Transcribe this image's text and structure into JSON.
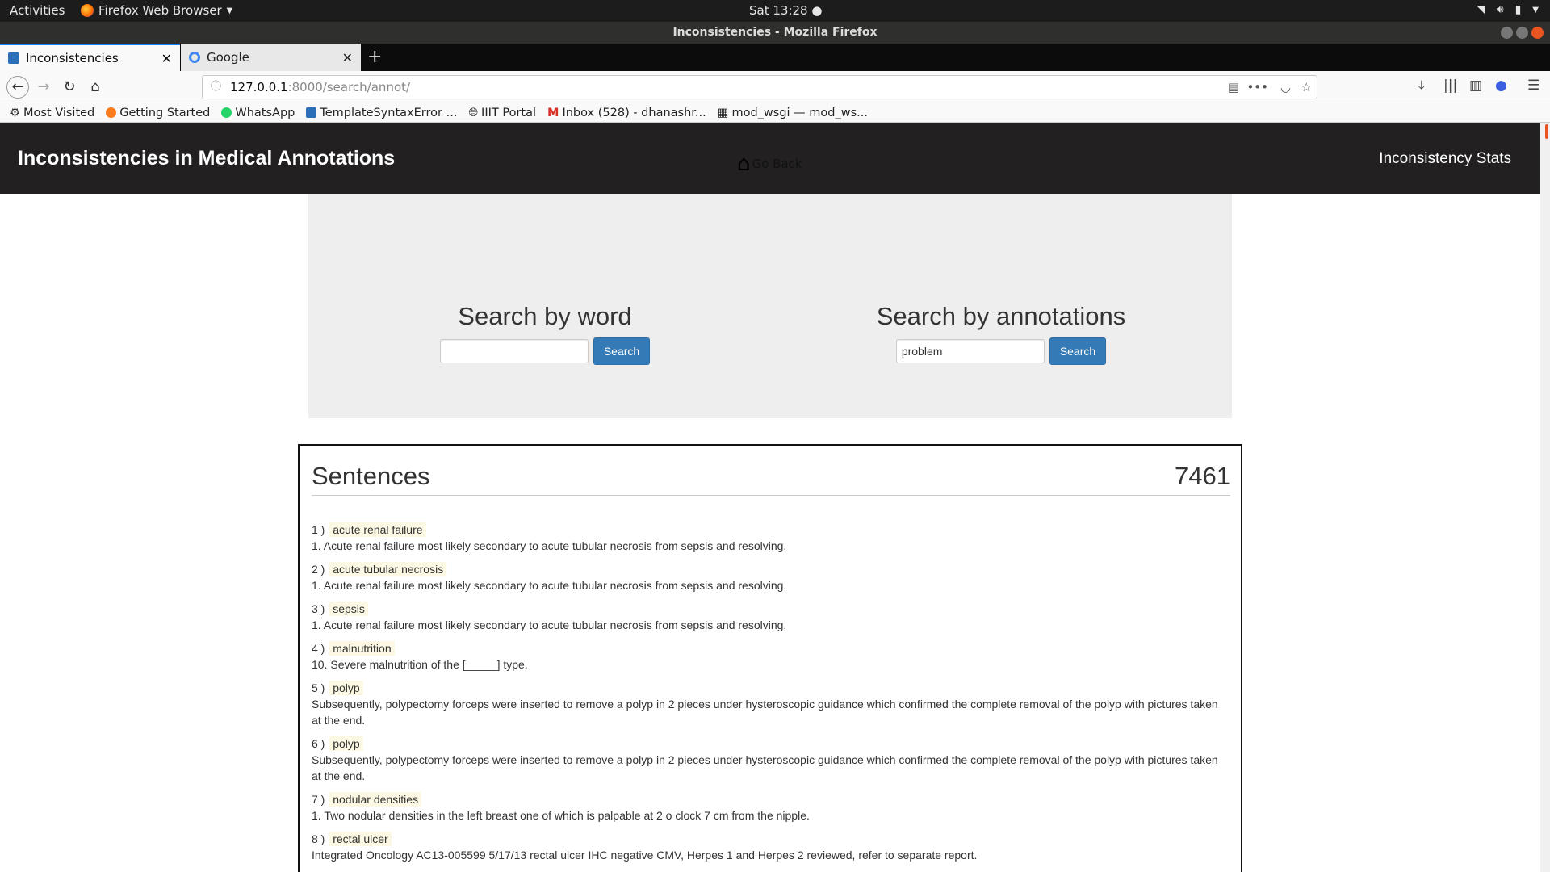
{
  "system": {
    "activities": "Activities",
    "app_name": "Firefox Web Browser",
    "clock": "Sat 13:28"
  },
  "window": {
    "title": "Inconsistencies - Mozilla Firefox"
  },
  "tabs": [
    {
      "label": "Inconsistencies",
      "active": true
    },
    {
      "label": "Google",
      "active": false
    }
  ],
  "urlbar": {
    "host": "127.0.0.1",
    "path": ":8000/search/annot/"
  },
  "bookmarks": [
    {
      "label": "Most Visited",
      "icon": "gear-icon"
    },
    {
      "label": "Getting Started",
      "icon": "firefox-icon"
    },
    {
      "label": "WhatsApp",
      "icon": "whatsapp-icon"
    },
    {
      "label": "TemplateSyntaxError ...",
      "icon": "django-icon"
    },
    {
      "label": "IIIT Portal",
      "icon": "globe-icon"
    },
    {
      "label": "Inbox (528) - dhanashr...",
      "icon": "gmail-icon"
    },
    {
      "label": "mod_wsgi — mod_ws...",
      "icon": "doc-icon"
    }
  ],
  "header": {
    "brand": "Inconsistencies in Medical Annotations",
    "go_back": "Go Back",
    "stats_link": "Inconsistency Stats"
  },
  "search_word": {
    "title": "Search by word",
    "value": "",
    "button": "Search"
  },
  "search_annot": {
    "title": "Search by annotations",
    "value": "problem",
    "button": "Search"
  },
  "results": {
    "title": "Sentences",
    "count": "7461",
    "items": [
      {
        "num": "1 )",
        "term": "acute renal failure",
        "sentence": "1. Acute renal failure most likely secondary to acute tubular necrosis from sepsis and resolving."
      },
      {
        "num": "2 )",
        "term": "acute tubular necrosis",
        "sentence": "1. Acute renal failure most likely secondary to acute tubular necrosis from sepsis and resolving."
      },
      {
        "num": "3 )",
        "term": "sepsis",
        "sentence": "1. Acute renal failure most likely secondary to acute tubular necrosis from sepsis and resolving."
      },
      {
        "num": "4 )",
        "term": "malnutrition",
        "sentence": "10. Severe malnutrition of the [_____] type."
      },
      {
        "num": "5 )",
        "term": "polyp",
        "sentence": "Subsequently, polypectomy forceps were inserted to remove a polyp in 2 pieces under hysteroscopic guidance which confirmed the complete removal of the polyp with pictures taken at the end."
      },
      {
        "num": "6 )",
        "term": "polyp",
        "sentence": "Subsequently, polypectomy forceps were inserted to remove a polyp in 2 pieces under hysteroscopic guidance which confirmed the complete removal of the polyp with pictures taken at the end."
      },
      {
        "num": "7 )",
        "term": "nodular densities",
        "sentence": "1. Two nodular densities in the left breast one of which is palpable at 2 o clock 7 cm from the nipple."
      },
      {
        "num": "8 )",
        "term": "rectal ulcer",
        "sentence": "Integrated Oncology AC13-005599 5/17/13 rectal ulcer IHC negative CMV, Herpes 1 and Herpes 2 reviewed, refer to separate report."
      }
    ]
  }
}
